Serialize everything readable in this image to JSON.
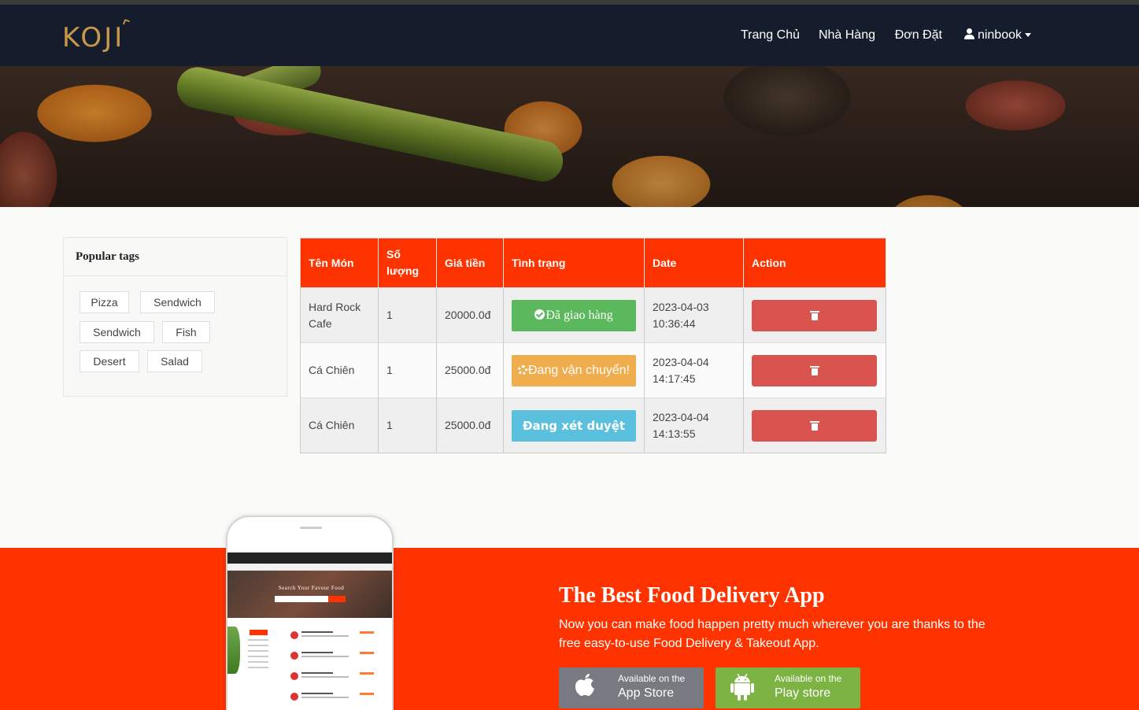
{
  "navbar": {
    "logo": "KOJI",
    "items": [
      "Trang Chủ",
      "Nhà Hàng",
      "Đơn Đặt"
    ],
    "user": "ninbook"
  },
  "sidebar": {
    "title": "Popular tags",
    "tags": [
      "Pizza",
      "Sendwich",
      "Sendwich",
      "Fish",
      "Desert",
      "Salad"
    ]
  },
  "orders": {
    "headers": [
      "Tên Món",
      "Số lượng",
      "Giá tiền",
      "Tình trạng",
      "Date",
      "Action"
    ],
    "rows": [
      {
        "name": "Hard Rock Cafe",
        "qty": "1",
        "price": "20000.0đ",
        "status": "Đã giao hàng",
        "date": "2023-04-03",
        "time": "10:36:44"
      },
      {
        "name": "Cá Chiên",
        "qty": "1",
        "price": "25000.0đ",
        "status": "Đang vận chuyển!",
        "date": "2023-04-04",
        "time": "14:17:45"
      },
      {
        "name": "Cá Chiên",
        "qty": "1",
        "price": "25000.0đ",
        "status": "Đang xét duyệt",
        "date": "2023-04-04",
        "time": "14:13:55"
      }
    ],
    "colors": {
      "header": "#ff3300",
      "delivered": "#5cb85c",
      "shipping": "#f0ad4e",
      "review": "#5bc0de",
      "delete": "#d9534f"
    }
  },
  "phone_screen": {
    "hero_title": "Search Your Favour Food"
  },
  "promo": {
    "title": "The Best Food Delivery App",
    "text": "Now you can make food happen pretty much wherever you are thanks to the free easy-to-use Food Delivery & Takeout App.",
    "apple_small": "Available on the",
    "apple_big": "App Store",
    "play_small": "Available on the",
    "play_big": "Play store",
    "background": "#ff3300"
  }
}
